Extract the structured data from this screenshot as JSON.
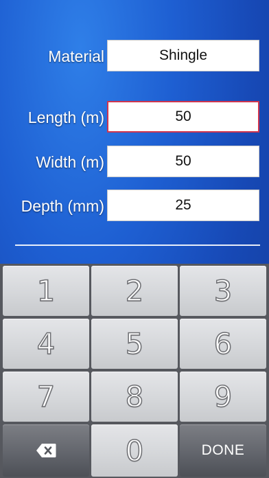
{
  "form": {
    "material": {
      "label": "Material",
      "value": "Shingle"
    },
    "length": {
      "label": "Length (m)",
      "value": "50"
    },
    "width": {
      "label": "Width (m)",
      "value": "50"
    },
    "depth": {
      "label": "Depth (mm)",
      "value": "25"
    }
  },
  "keypad": {
    "keys": [
      "1",
      "2",
      "3",
      "4",
      "5",
      "6",
      "7",
      "8",
      "9"
    ],
    "zero": "0",
    "done": "DONE",
    "backspace_icon": "backspace-icon"
  },
  "colors": {
    "background": "#1e5fd2",
    "active_field_border": "#d0354e",
    "keypad_bg": "#56585e"
  }
}
